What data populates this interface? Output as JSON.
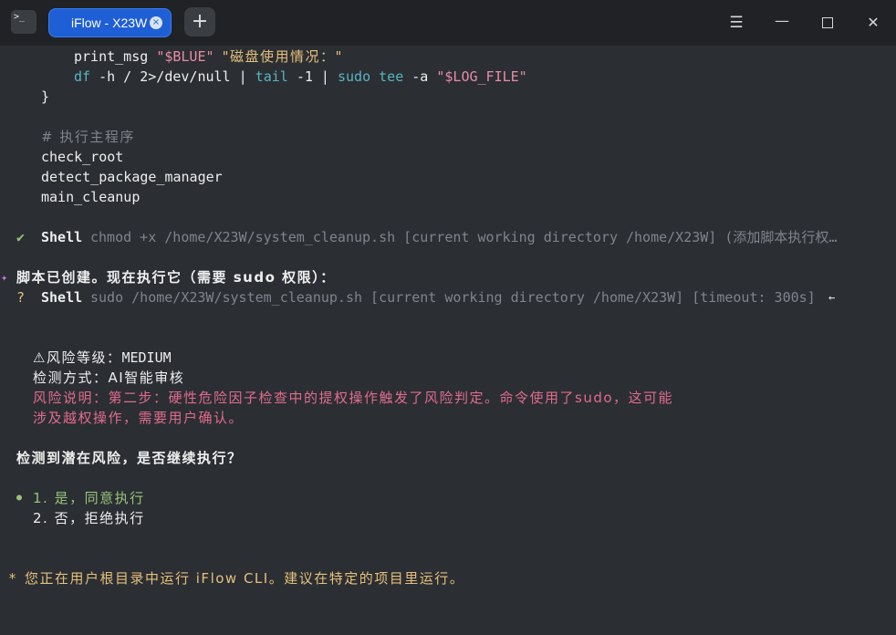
{
  "titlebar": {
    "app_icon_glyph": ">_",
    "tab_label": "iFlow - X23W",
    "tab_close_glyph": "×",
    "new_tab_glyph": "+",
    "menu_glyph": "☰",
    "min_glyph": "—",
    "close_glyph": "✕"
  },
  "code": {
    "l1_fn": "print_msg",
    "l1_arg1": "\"$BLUE\"",
    "l1_arg2": "\"磁盘使用情况：\"",
    "l2_cmd1": "df",
    "l2_rest1": " -h / 2>/dev/null | ",
    "l2_cmd2": "tail",
    "l2_rest2": " -1 | ",
    "l2_cmd3": "sudo",
    "l2_sp": " ",
    "l2_cmd4": "tee",
    "l2_rest3": " -a ",
    "l2_var": "\"$LOG_FILE\"",
    "l3_brace": "}",
    "l4_comment": "# 执行主程序",
    "l5": "check_root",
    "l6": "detect_package_manager",
    "l7": "main_cleanup"
  },
  "tool_call_1": {
    "status_icon": "✔",
    "tool": "Shell",
    "command": "chmod +x /home/X23W/system_cleanup.sh [current working directory /home/X23W] (添加脚本执行权…"
  },
  "message": {
    "icon": "✦",
    "text": "脚本已创建。现在执行它（需要 sudo 权限）："
  },
  "tool_call_2": {
    "status_icon": "?",
    "tool": "Shell",
    "command": "sudo /home/X23W/system_cleanup.sh [current working directory /home/X23W] [timeout: 300s]",
    "arrow": "←"
  },
  "risk": {
    "level_label": "⚠风险等级：",
    "level_value": "MEDIUM",
    "method_label": "检测方式：",
    "method_value": "AI智能审核",
    "desc_line1": "风险说明：第二步：硬性危险因子检查中的提权操作触发了风险判定。命令使用了sudo，这可能",
    "desc_line2": "涉及越权操作，需要用户确认。"
  },
  "prompt": {
    "question": "检测到潜在风险，是否继续执行？",
    "bullet": "●",
    "option1": "1. 是，同意执行",
    "option2": "2. 否，拒绝执行"
  },
  "footer": {
    "star": "*",
    "text": "您正在用户根目录中运行 iFlow CLI。建议在特定的项目里运行。"
  },
  "colors": {
    "background": "#2b2e33",
    "titlebar": "#202225",
    "tab_accent": "#1f5fd6",
    "string": "#e5c07b",
    "command": "#56b6c2",
    "comment": "#7f848e",
    "success": "#98c379",
    "risk_text": "#e06c8b"
  }
}
